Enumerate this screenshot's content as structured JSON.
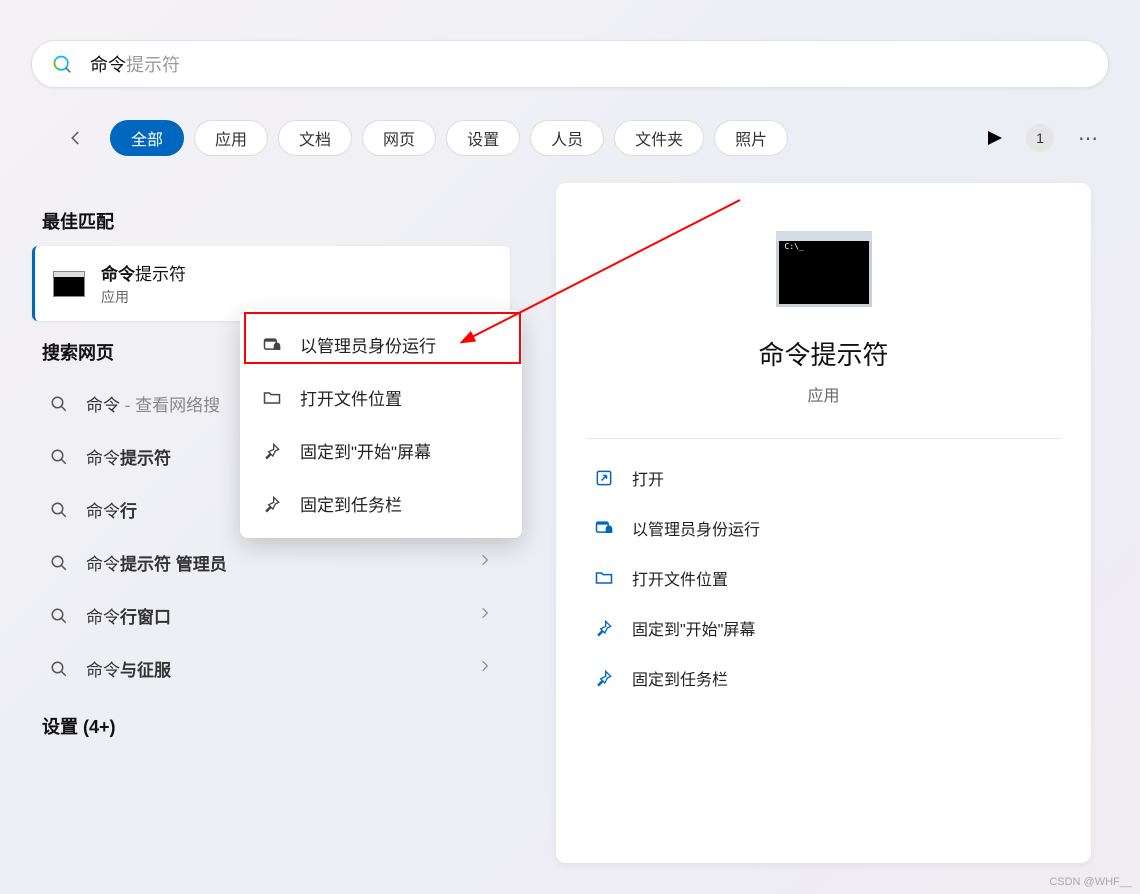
{
  "search": {
    "value": "命令",
    "suffix": "提示符"
  },
  "filters": {
    "items": [
      "全部",
      "应用",
      "文档",
      "网页",
      "设置",
      "人员",
      "文件夹",
      "照片"
    ],
    "active_index": 0
  },
  "badge": "1",
  "sections": {
    "best_match": "最佳匹配",
    "search_web": "搜索网页",
    "settings": "设置 (4+)"
  },
  "best": {
    "bold": "命令",
    "rest": "提示符",
    "sub": "应用"
  },
  "web_results": [
    {
      "pre": "命令",
      "bold": "",
      "suffix": " - 查看网络搜",
      "has_chevron": false
    },
    {
      "pre": "命令",
      "bold": "提示符",
      "suffix": "",
      "has_chevron": true
    },
    {
      "pre": "命令",
      "bold": "行",
      "suffix": "",
      "has_chevron": true
    },
    {
      "pre": "命令",
      "bold": "提示符 管理员",
      "suffix": "",
      "has_chevron": true
    },
    {
      "pre": "命令",
      "bold": "行窗口",
      "suffix": "",
      "has_chevron": true
    },
    {
      "pre": "命令",
      "bold": "与征服",
      "suffix": "",
      "has_chevron": true
    }
  ],
  "context_menu": [
    {
      "icon": "admin-icon",
      "label": "以管理员身份运行"
    },
    {
      "icon": "folder-icon",
      "label": "打开文件位置"
    },
    {
      "icon": "pin-icon",
      "label": "固定到\"开始\"屏幕"
    },
    {
      "icon": "pin-icon",
      "label": "固定到任务栏"
    }
  ],
  "preview": {
    "title": "命令提示符",
    "sub": "应用",
    "actions": [
      {
        "icon": "open-icon",
        "label": "打开"
      },
      {
        "icon": "admin-icon",
        "label": "以管理员身份运行"
      },
      {
        "icon": "folder-icon",
        "label": "打开文件位置"
      },
      {
        "icon": "pin-icon",
        "label": "固定到\"开始\"屏幕"
      },
      {
        "icon": "pin-icon",
        "label": "固定到任务栏"
      }
    ]
  },
  "watermark": "CSDN @WHF__"
}
